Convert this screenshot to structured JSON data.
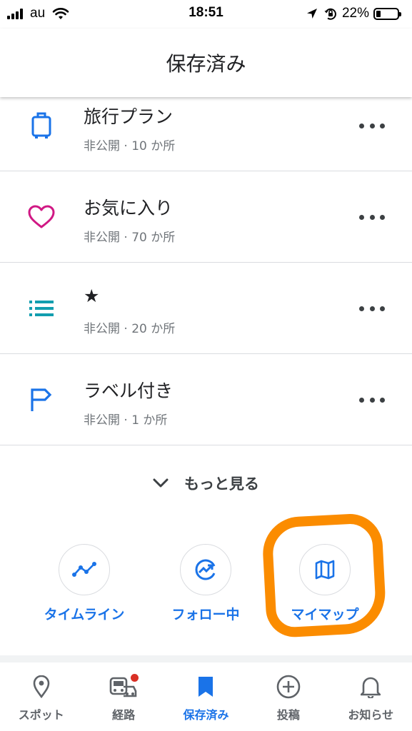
{
  "status_bar": {
    "carrier": "au",
    "time": "18:51",
    "battery": "22%",
    "battery_level": 0.22
  },
  "header": {
    "title": "保存済み"
  },
  "lists": [
    {
      "icon": "suitcase-icon",
      "title": "旅行プラン",
      "subtitle": "非公開 · 10 か所",
      "color": "#1a73e8"
    },
    {
      "icon": "heart-icon",
      "title": "お気に入り",
      "subtitle": "非公開 · 70 か所",
      "color": "#d01884"
    },
    {
      "icon": "list-icon",
      "title": "★",
      "subtitle": "非公開 · 20 か所",
      "color": "#129eaf"
    },
    {
      "icon": "flag-icon",
      "title": "ラベル付き",
      "subtitle": "非公開 · 1 か所",
      "color": "#1a73e8"
    }
  ],
  "more_link": {
    "label": "もっと見る",
    "icon": "chevron-down-icon"
  },
  "shortcuts": [
    {
      "icon": "timeline-icon",
      "label": "タイムライン"
    },
    {
      "icon": "following-icon",
      "label": "フォロー中"
    },
    {
      "icon": "map-icon",
      "label": "マイマップ"
    }
  ],
  "bottom_nav": [
    {
      "icon": "location-pin-icon",
      "label": "スポット",
      "active": false
    },
    {
      "icon": "commute-icon",
      "label": "経路",
      "active": false,
      "has_badge": true
    },
    {
      "icon": "bookmark-icon",
      "label": "保存済み",
      "active": true
    },
    {
      "icon": "add-circle-icon",
      "label": "投稿",
      "active": false
    },
    {
      "icon": "bell-icon",
      "label": "お知らせ",
      "active": false
    }
  ],
  "colors": {
    "accent": "#1a73e8",
    "highlight": "#fb8c00",
    "badge": "#d93025"
  }
}
